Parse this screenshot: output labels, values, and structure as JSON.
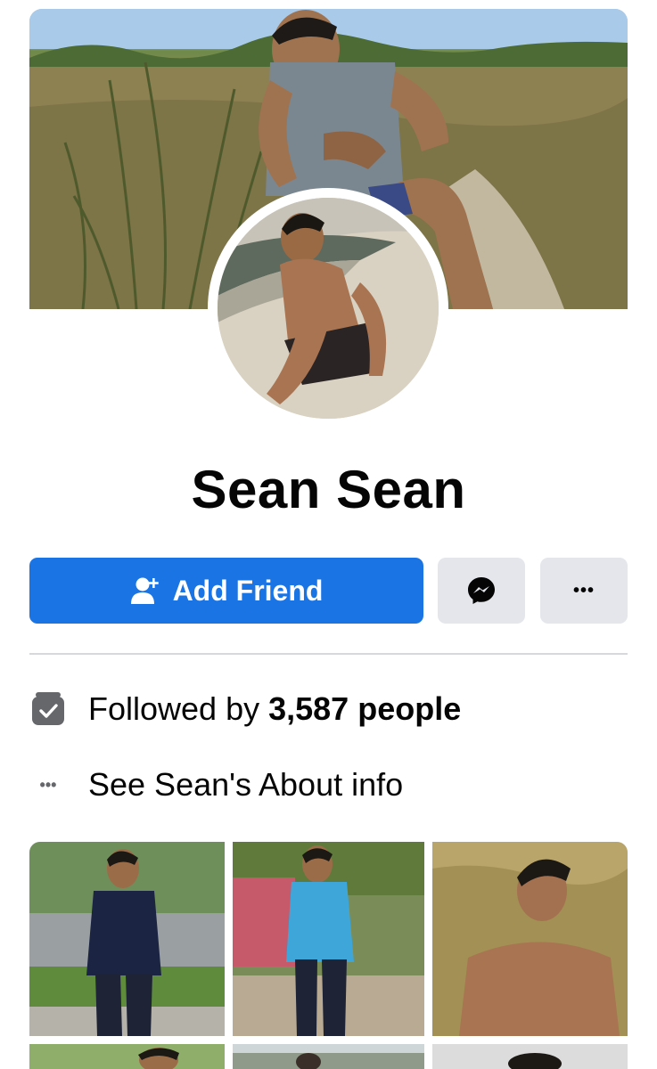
{
  "profile": {
    "name": "Sean Sean"
  },
  "actions": {
    "add_friend_label": "Add Friend",
    "messenger_icon": "messenger-icon",
    "more_label": "•••"
  },
  "intro": {
    "followed_prefix": "Followed by ",
    "followed_count": "3,587 people",
    "about_label": "See Sean's About info",
    "about_icon_glyph": "•••"
  },
  "colors": {
    "primary": "#1b74e4",
    "secondary_button": "#e4e6eb"
  },
  "photos": [
    {
      "name": "photo-1"
    },
    {
      "name": "photo-2"
    },
    {
      "name": "photo-3"
    },
    {
      "name": "photo-4"
    },
    {
      "name": "photo-5"
    },
    {
      "name": "photo-6"
    }
  ]
}
